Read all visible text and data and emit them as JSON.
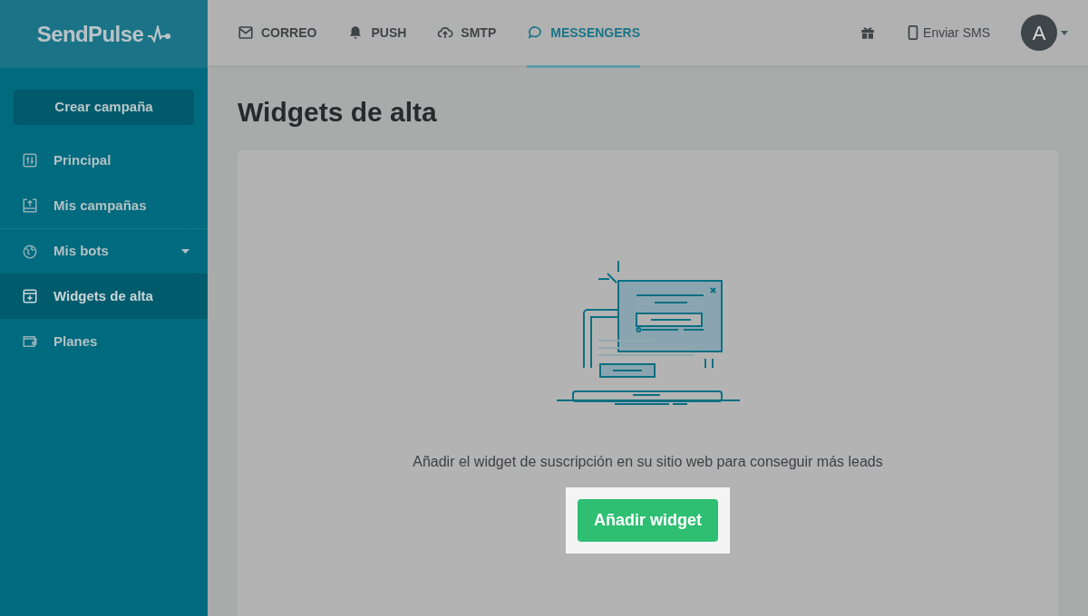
{
  "logo": "SendPulse",
  "top_nav": [
    {
      "kind": "mail",
      "label": "CORREO",
      "selected": false
    },
    {
      "kind": "bell",
      "label": "PUSH",
      "selected": false
    },
    {
      "kind": "cloud",
      "label": "SMTP",
      "selected": false
    },
    {
      "kind": "chat",
      "label": "MESSENGERS",
      "selected": true
    }
  ],
  "top_right": {
    "sms_label": "Enviar SMS",
    "avatar": "A"
  },
  "sidebar": {
    "create_button": "Crear campaña",
    "items": [
      {
        "kind": "sliders",
        "label": "Principal",
        "selected": false,
        "expandable": false
      },
      {
        "kind": "upload",
        "label": "Mis campañas",
        "selected": false,
        "expandable": false
      },
      {
        "kind": "globe",
        "label": "Mis bots",
        "selected": false,
        "expandable": true
      },
      {
        "kind": "widget",
        "label": "Widgets de alta",
        "selected": true,
        "expandable": false
      },
      {
        "kind": "wallet",
        "label": "Planes",
        "selected": false,
        "expandable": false
      }
    ]
  },
  "page": {
    "title": "Widgets de alta",
    "description": "Añadir el widget de suscripción en su sitio web para conseguir más leads",
    "button": "Añadir widget"
  }
}
